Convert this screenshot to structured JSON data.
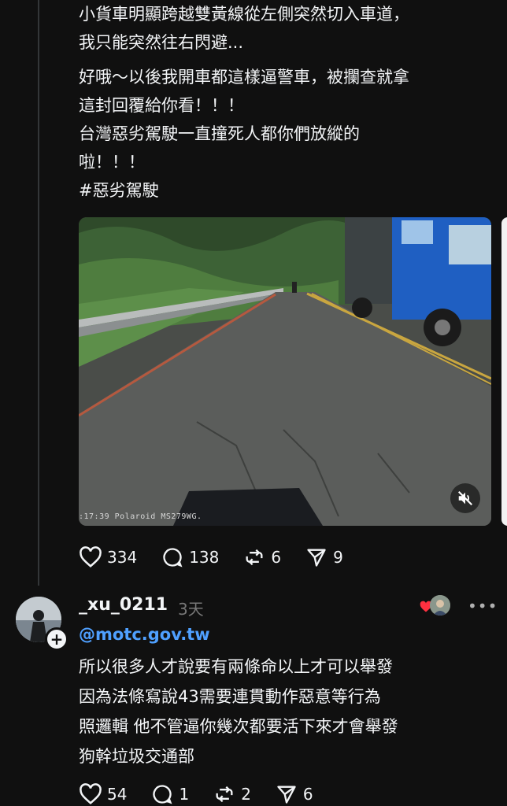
{
  "post": {
    "text_lines": [
      "小貨車明顯跨越雙黃線從左側突然切入車道，",
      "我只能突然往右閃避...",
      "好哦～以後我開車都這樣逼警車，被攔查就拿",
      "這封回覆給你看！！！",
      "台灣惡劣駕駛一直撞死人都你們放縱的",
      "啦！！！",
      "#惡劣駕駛"
    ],
    "video": {
      "overlay_text": ":17:39  Polaroid MS279WG.",
      "mute_icon": "volume-off-icon"
    },
    "actions": {
      "likes": "334",
      "comments": "138",
      "reposts": "6",
      "shares": "9"
    }
  },
  "reply": {
    "username": "_xu_0211",
    "time": "3天",
    "mention": "@motc.gov.tw",
    "text_lines": [
      "所以很多人才說要有兩條命以上才可以舉發",
      "因為法條寫說43需要連貫動作惡意等行為",
      "照邏輯 他不管逼你幾次都要活下來才會舉發",
      "狗幹垃圾交通部"
    ],
    "actions": {
      "likes": "54",
      "comments": "1",
      "reposts": "2",
      "shares": "6"
    },
    "more_label": "•••",
    "add_label": "+"
  },
  "colors": {
    "background": "#101010",
    "text": "#f3f5f7",
    "secondary": "#777777",
    "link": "#4fa0ff",
    "heart": "#ff3040"
  }
}
